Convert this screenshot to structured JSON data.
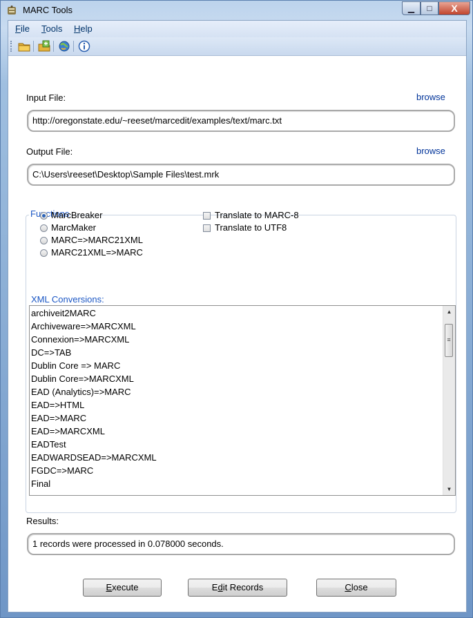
{
  "window": {
    "title": "MARC Tools",
    "min_glyph": "▁",
    "max_glyph": "□",
    "close_glyph": "X"
  },
  "menu": [
    {
      "mnemonic": "F",
      "rest": "ile"
    },
    {
      "mnemonic": "T",
      "rest": "ools"
    },
    {
      "mnemonic": "H",
      "rest": "elp"
    }
  ],
  "toolbar": {
    "icons": [
      "open-folder-icon",
      "open-file-icon",
      "globe-refresh-icon",
      "info-icon"
    ]
  },
  "input_file": {
    "label": "Input File:",
    "browse": "browse",
    "value": "http://oregonstate.edu/~reeset/marcedit/examples/text/marc.txt"
  },
  "output_file": {
    "label": "Output File:",
    "browse": "browse",
    "value": "C:\\Users\\reeset\\Desktop\\Sample Files\\test.mrk"
  },
  "functions": {
    "title": "Functions",
    "radios": [
      {
        "label": "MarcBreaker",
        "checked": true
      },
      {
        "label": "MarcMaker",
        "checked": false
      },
      {
        "label": "MARC=>MARC21XML",
        "checked": false
      },
      {
        "label": "MARC21XML=>MARC",
        "checked": false
      }
    ],
    "checkboxes": [
      {
        "label": "Translate to MARC-8",
        "checked": false
      },
      {
        "label": "Translate to UTF8",
        "checked": false
      }
    ]
  },
  "xml_conversions": {
    "title": "XML Conversions:",
    "items": [
      "archiveit2MARC",
      "Archiveware=>MARCXML",
      "Connexion=>MARCXML",
      "DC=>TAB",
      "Dublin Core => MARC",
      "Dublin Core=>MARCXML",
      "EAD (Analytics)=>MARC",
      "EAD=>HTML",
      "EAD=>MARC",
      "EAD=>MARCXML",
      "EADTest",
      "EADWARDSEAD=>MARCXML",
      "FGDC=>MARC",
      "Final"
    ],
    "scrollbar": {
      "up": "▲",
      "down": "▼",
      "grip": "≡"
    }
  },
  "results": {
    "label": "Results:",
    "value": "1 records were processed in 0.078000 seconds."
  },
  "buttons": {
    "execute": {
      "mnemonic": "E",
      "rest": "xecute"
    },
    "edit": {
      "pre": "E",
      "mnemonic": "d",
      "rest": "it Records"
    },
    "close": {
      "mnemonic": "C",
      "rest": "lose"
    }
  }
}
